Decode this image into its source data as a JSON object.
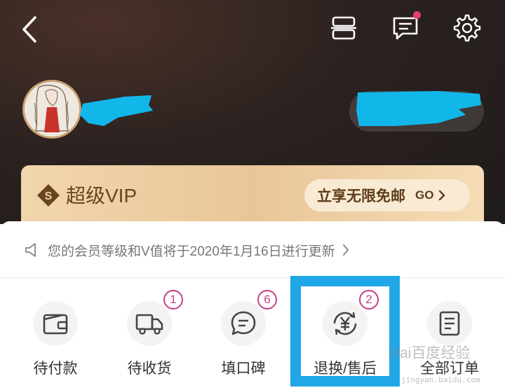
{
  "header": {
    "icons": [
      "back-icon",
      "scan-icon",
      "message-icon",
      "settings-icon"
    ],
    "message_has_dot": true
  },
  "profile": {
    "avatar": "avatar-illustration"
  },
  "vip": {
    "title": "超级VIP",
    "cta_label": "立享无限免邮",
    "cta_go": "GO"
  },
  "notice": {
    "text": "您的会员等级和V值将于2020年1月16日进行更新"
  },
  "orders": [
    {
      "label": "待付款",
      "icon": "wallet-icon",
      "badge": ""
    },
    {
      "label": "待收货",
      "icon": "truck-icon",
      "badge": "1"
    },
    {
      "label": "填口碑",
      "icon": "comment-icon",
      "badge": "6"
    },
    {
      "label": "退换/售后",
      "icon": "refund-icon",
      "badge": "2"
    },
    {
      "label": "全部订单",
      "icon": "order-list-icon",
      "badge": ""
    }
  ],
  "watermark": {
    "text": "Bai百度经验",
    "sub": "jingyan.baidu.com"
  },
  "colors": {
    "header_bg": "#2b2220",
    "vip_gold": "#e9c697",
    "badge": "#c2408a",
    "highlight": "#1fa7e8",
    "notification_dot": "#e83c7a"
  }
}
